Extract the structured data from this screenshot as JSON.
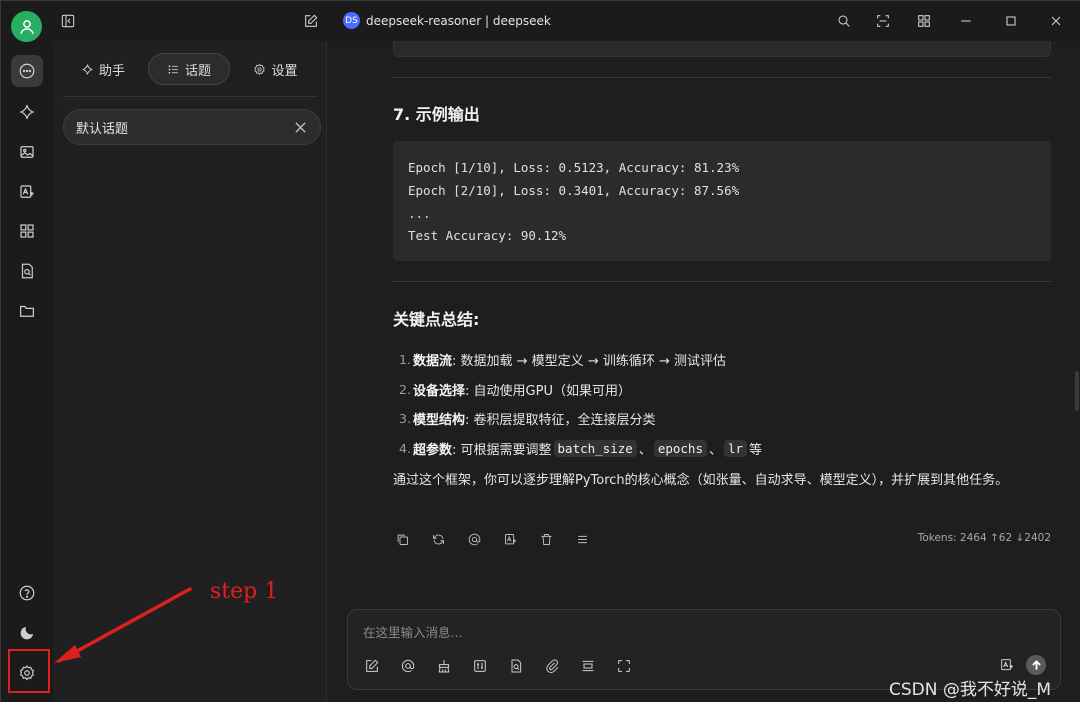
{
  "window": {
    "model_label": "deepseek-reasoner | deepseek",
    "model_logo_text": "DS"
  },
  "sidebar_tabs": {
    "assistant": "助手",
    "topics": "话题",
    "settings": "设置"
  },
  "topics": [
    {
      "title": "默认话题"
    }
  ],
  "content": {
    "heading_example": "7. 示例输出",
    "code_lines": [
      "Epoch [1/10], Loss: 0.5123, Accuracy: 81.23%",
      "Epoch [2/10], Loss: 0.3401, Accuracy: 87.56%",
      "...",
      "Test Accuracy: 90.12%"
    ],
    "heading_summary": "关键点总结:",
    "list": [
      {
        "num": "1.",
        "bold": "数据流",
        "text": ": 数据加载 → 模型定义 → 训练循环 → 测试评估"
      },
      {
        "num": "2.",
        "bold": "设备选择",
        "text": ": 自动使用GPU（如果可用）"
      },
      {
        "num": "3.",
        "bold": "模型结构",
        "text": ": 卷积层提取特征，全连接层分类"
      },
      {
        "num": "4.",
        "bold": "超参数",
        "text": ": 可根据需要调整",
        "code1": "batch_size",
        "sep1": "、",
        "code2": "epochs",
        "sep2": "、",
        "code3": "lr",
        "tail": "等"
      }
    ],
    "paragraph": "通过这个框架，你可以逐步理解PyTorch的核心概念（如张量、自动求导、模型定义），并扩展到其他任务。",
    "tokens": "Tokens: 2464 ↑62 ↓2402"
  },
  "input": {
    "placeholder": "在这里输入消息..."
  },
  "annotation": {
    "step_label": "step 1",
    "color": "#e0201f"
  },
  "watermark": "CSDN @我不好说_M",
  "colors": {
    "avatar": "#27ae60",
    "model_logo": "#4d6bfe"
  }
}
